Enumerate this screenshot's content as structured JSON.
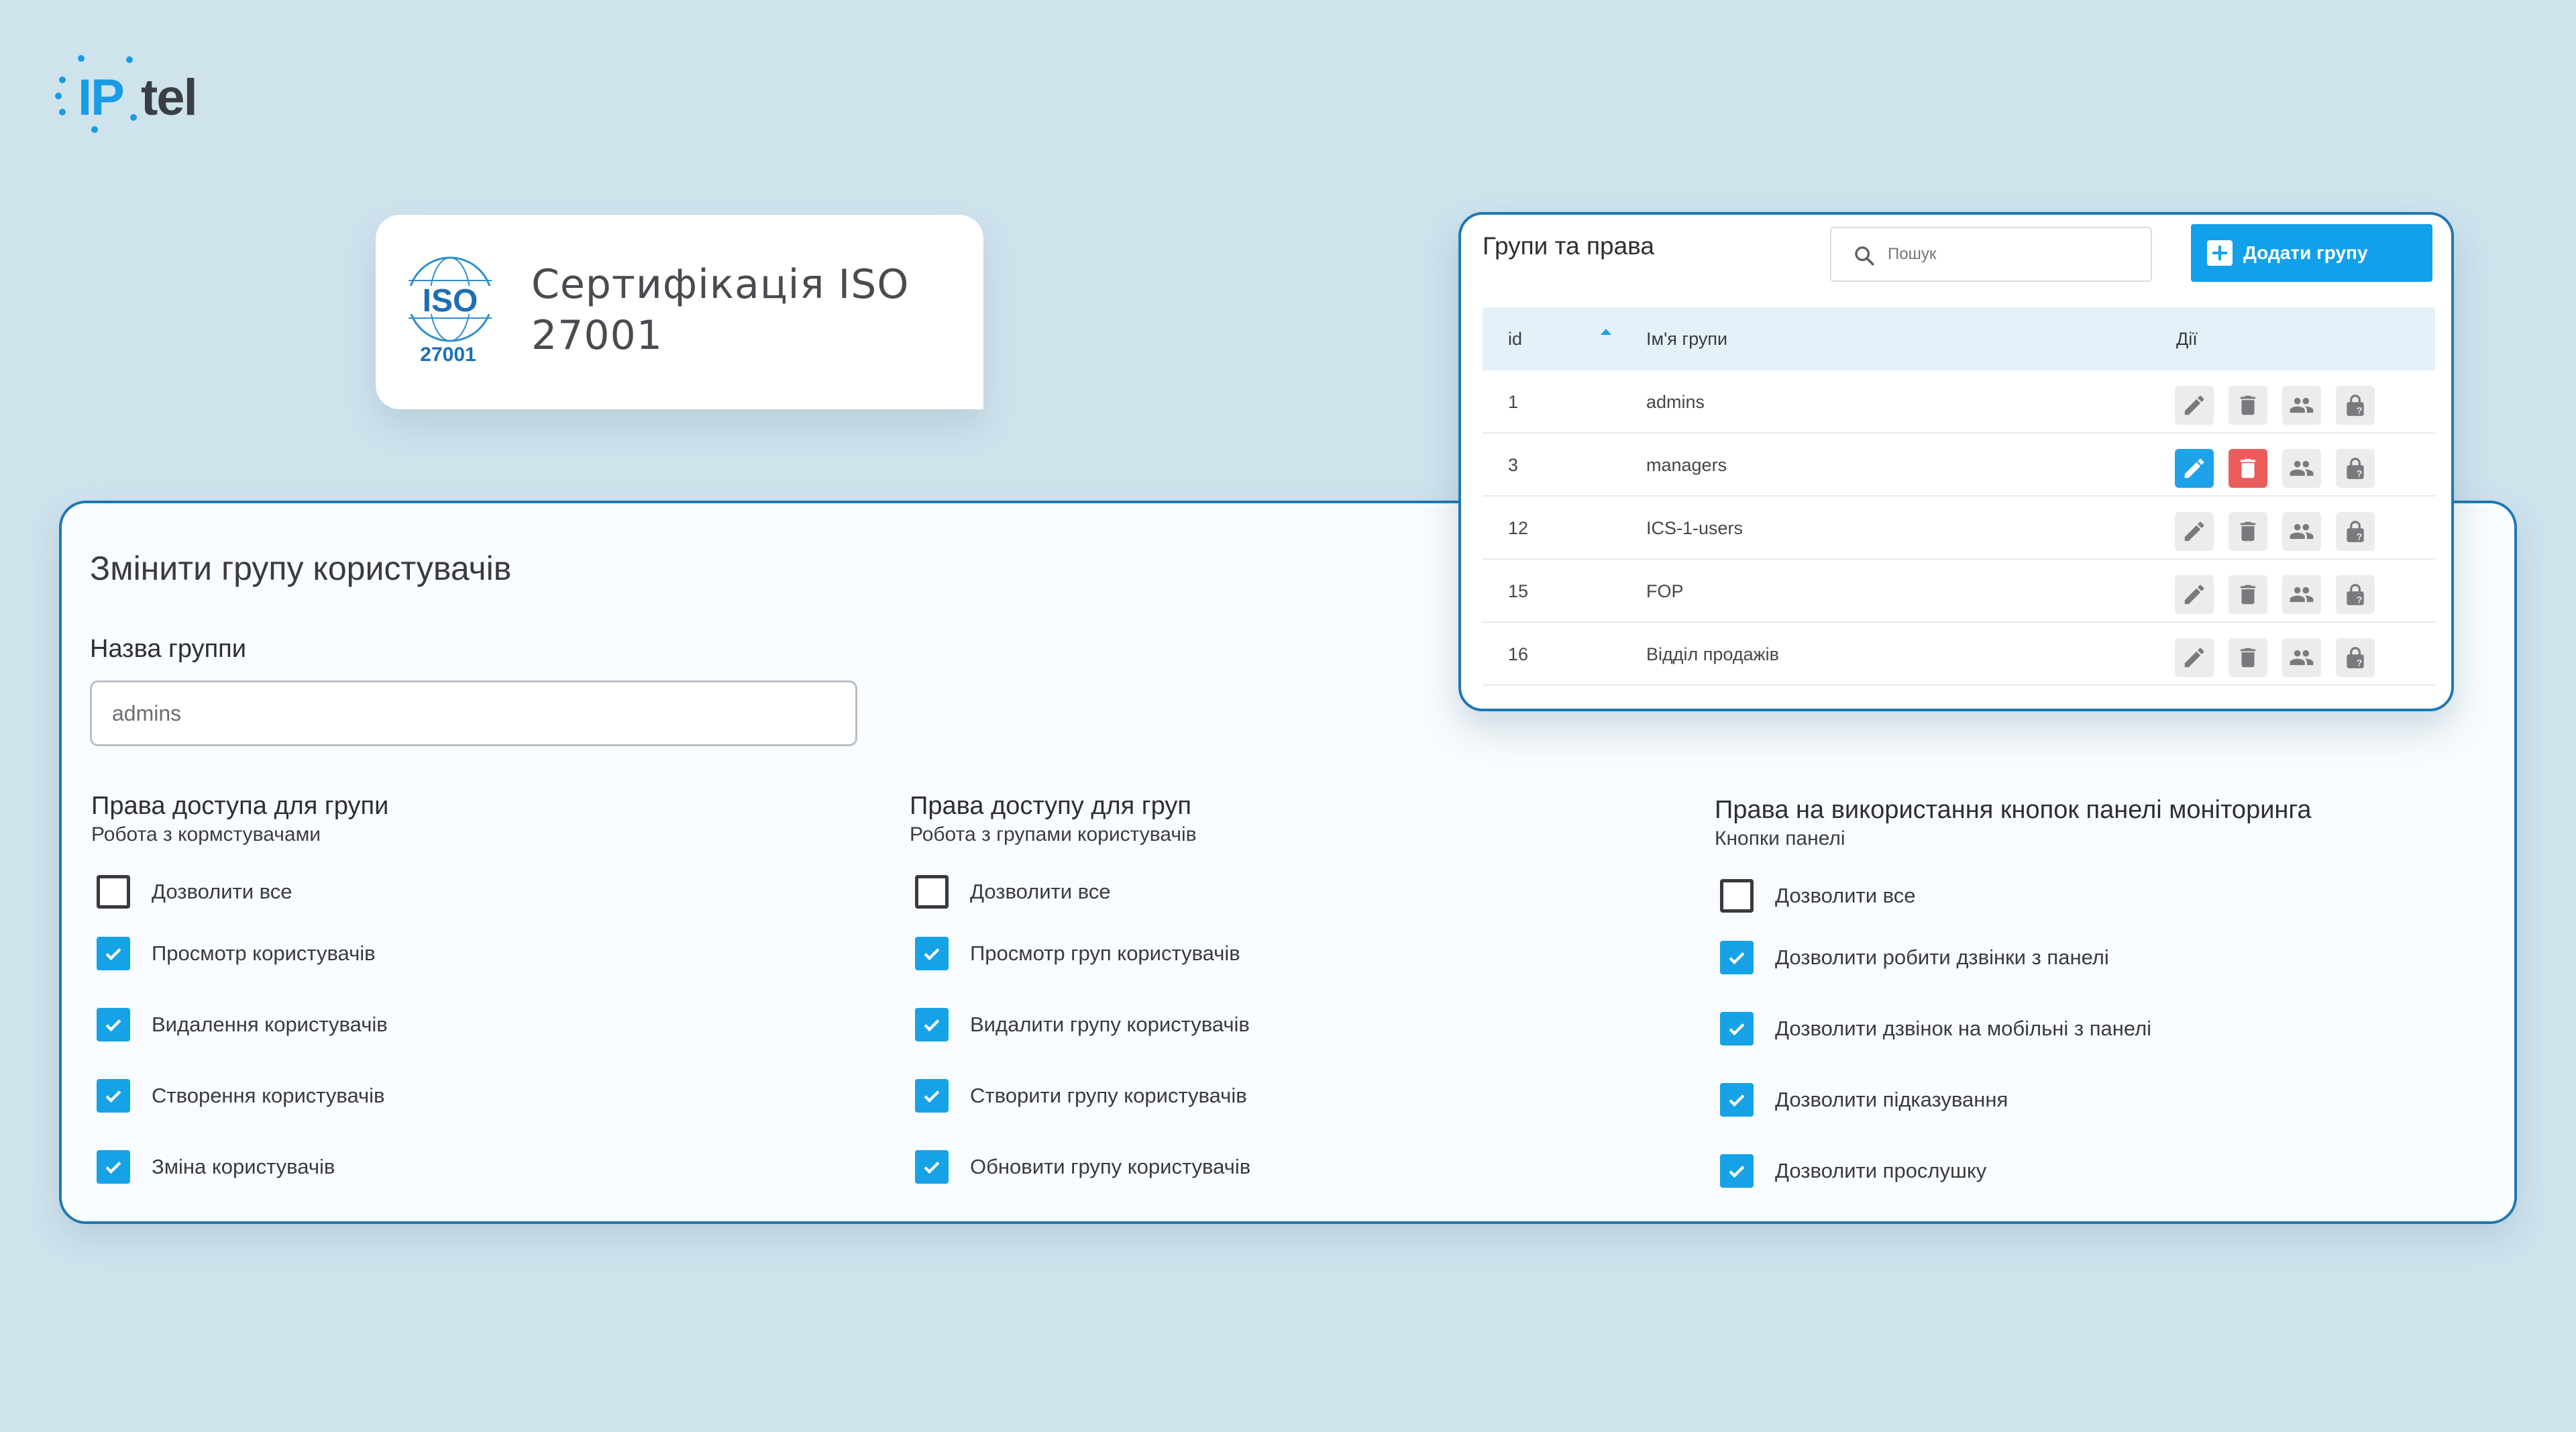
{
  "brand": {
    "ip": "IP",
    "tel": "tel"
  },
  "colors": {
    "accent": "#16a2e6",
    "danger": "#ea5c5c",
    "panel_border": "#1f78b4",
    "background": "#cfe3ed"
  },
  "iso": {
    "badge_text": "ISO",
    "badge_number": "27001",
    "title": "Сертифікація ISO 27001"
  },
  "edit": {
    "title": "Змінити групу користувачів",
    "name_label": "Назва группи",
    "name_value": "admins",
    "columns": [
      {
        "title": "Права доступа для групи",
        "subtitle": "Робота з кормстувачами",
        "items": [
          {
            "label": "Дозволити все",
            "checked": false
          },
          {
            "label": "Просмотр користувачів",
            "checked": true
          },
          {
            "label": "Видалення користувачів",
            "checked": true
          },
          {
            "label": "Створення користувачів",
            "checked": true
          },
          {
            "label": "Зміна користувачів",
            "checked": true
          }
        ]
      },
      {
        "title": "Права доступу для груп",
        "subtitle": "Робота з групами користувачів",
        "items": [
          {
            "label": "Дозволити все",
            "checked": false
          },
          {
            "label": "Просмотр груп користувачів",
            "checked": true
          },
          {
            "label": "Видалити групу користувачів",
            "checked": true
          },
          {
            "label": "Створити групу користувачів",
            "checked": true
          },
          {
            "label": "Обновити групу користувачів",
            "checked": true
          }
        ]
      },
      {
        "title": "Права на використання кнопок панелі моніторинга",
        "subtitle": "Кнопки панелі",
        "items": [
          {
            "label": "Дозволити все",
            "checked": false
          },
          {
            "label": "Дозволити робити дзвінки з панелі",
            "checked": true
          },
          {
            "label": "Дозволити дзвінок на мобільні з панелі",
            "checked": true
          },
          {
            "label": "Дозволити підказування",
            "checked": true
          },
          {
            "label": "Дозволити прослушку",
            "checked": true
          }
        ]
      }
    ]
  },
  "groups": {
    "title": "Групи та права",
    "search_placeholder": "Пошук",
    "add_label": "Додати групу",
    "headers": {
      "id": "id",
      "name": "Ім'я групи",
      "actions": "Дії"
    },
    "rows": [
      {
        "id": "1",
        "name": "admins",
        "active": false
      },
      {
        "id": "3",
        "name": "managers",
        "active": true
      },
      {
        "id": "12",
        "name": "ICS-1-users",
        "active": false
      },
      {
        "id": "15",
        "name": "FOP",
        "active": false
      },
      {
        "id": "16",
        "name": "Відділ продажів",
        "active": false
      }
    ],
    "action_icons": [
      "edit-icon",
      "delete-icon",
      "users-icon",
      "lock-icon"
    ]
  }
}
